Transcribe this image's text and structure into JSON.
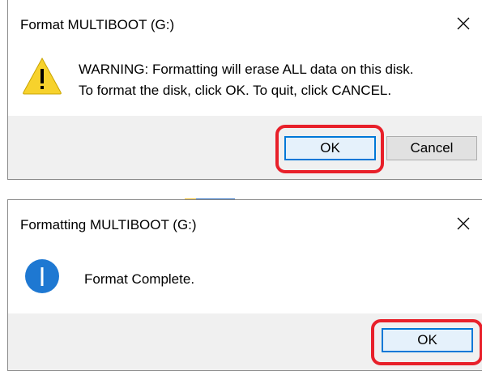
{
  "format_dialog": {
    "title": "Format MULTIBOOT (G:)",
    "close_icon": "close-icon",
    "icon": "warning-icon",
    "message_line1": "WARNING: Formatting will erase ALL data on this disk.",
    "message_line2": "To format the disk, click OK. To quit, click CANCEL.",
    "ok_label": "OK",
    "cancel_label": "Cancel"
  },
  "complete_dialog": {
    "title": "Formatting MULTIBOOT (G:)",
    "close_icon": "close-icon",
    "icon": "info-icon",
    "message": "Format Complete.",
    "ok_label": "OK"
  },
  "colors": {
    "highlight": "#e8202a",
    "default_button_border": "#0078d7",
    "footer_bg": "#f0f0f0",
    "warning_yellow": "#f7d22c",
    "info_blue": "#1e78d2"
  }
}
